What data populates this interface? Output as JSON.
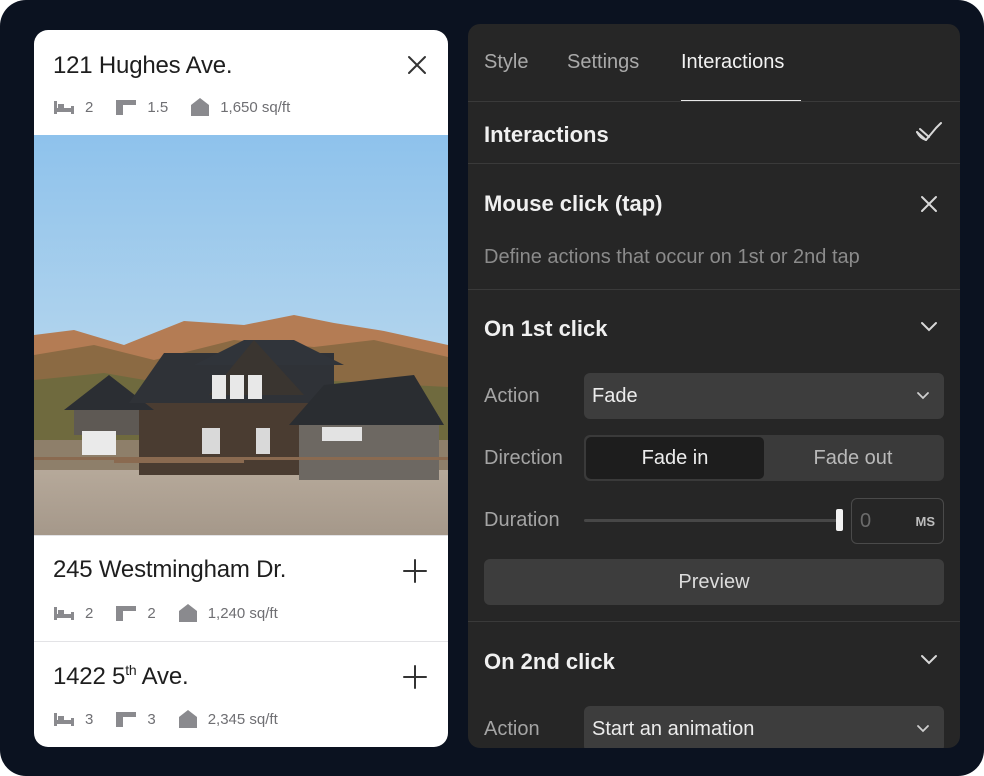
{
  "listings": [
    {
      "address": "121 Hughes Ave.",
      "beds": "2",
      "baths": "1.5",
      "area": "1,650 sq/ft"
    },
    {
      "address": "245 Westmingham Dr.",
      "beds": "2",
      "baths": "2",
      "area": "1,240 sq/ft"
    },
    {
      "address_main": "1422 5",
      "address_sup": "th",
      "address_tail": " Ave.",
      "beds": "3",
      "baths": "3",
      "area": "2,345 sq/ft"
    }
  ],
  "icons": {
    "close": "close-icon",
    "add": "plus-icon",
    "bed": "bed-icon",
    "bath": "bathtub-icon",
    "home": "house-icon",
    "brush": "brush-icon",
    "chevron": "chevron-down-icon"
  },
  "panel": {
    "tabs": [
      "Style",
      "Settings",
      "Interactions"
    ],
    "active_tab": "Interactions",
    "heading": "Interactions",
    "trigger": {
      "title": "Mouse click (tap)",
      "description": "Define actions that occur on 1st or 2nd tap"
    },
    "first_click": {
      "title": "On 1st click",
      "action_label": "Action",
      "action_value": "Fade",
      "direction_label": "Direction",
      "direction_options": [
        "Fade in",
        "Fade out"
      ],
      "direction_selected": "Fade in",
      "duration_label": "Duration",
      "duration_placeholder": "0",
      "duration_unit": "MS",
      "duration_slider_level": 1.0,
      "preview_label": "Preview"
    },
    "second_click": {
      "title": "On 2nd click",
      "action_label": "Action",
      "action_value": "Start an animation"
    }
  },
  "colors": {
    "background": "#0b1220",
    "panel": "#262626",
    "control": "#3d3d3d",
    "card": "#ffffff"
  }
}
